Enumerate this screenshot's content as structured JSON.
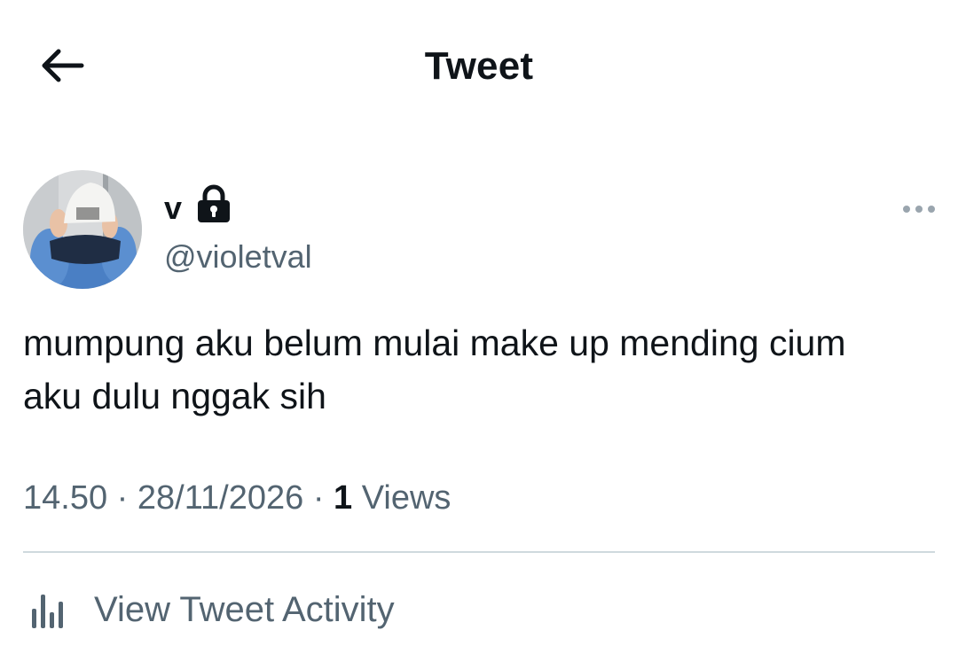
{
  "header": {
    "title": "Tweet",
    "back_icon": "arrow-left-icon"
  },
  "author": {
    "display_name": "v",
    "handle": "@violetval",
    "protected_icon": "lock-icon",
    "avatar_icon": "avatar-photo"
  },
  "tweet": {
    "text": "mumpung aku belum mulai make up mending cium aku dulu nggak sih",
    "time": "14.50",
    "separator": "·",
    "date": "28/11/2026",
    "views_count": "1",
    "views_label": "Views"
  },
  "actions": {
    "more_icon": "more-horizontal-icon",
    "activity_icon": "bar-chart-icon",
    "activity_label": "View Tweet Activity"
  },
  "colors": {
    "text_primary": "#0f1419",
    "text_secondary": "#536471",
    "divider": "#cfd9de"
  }
}
